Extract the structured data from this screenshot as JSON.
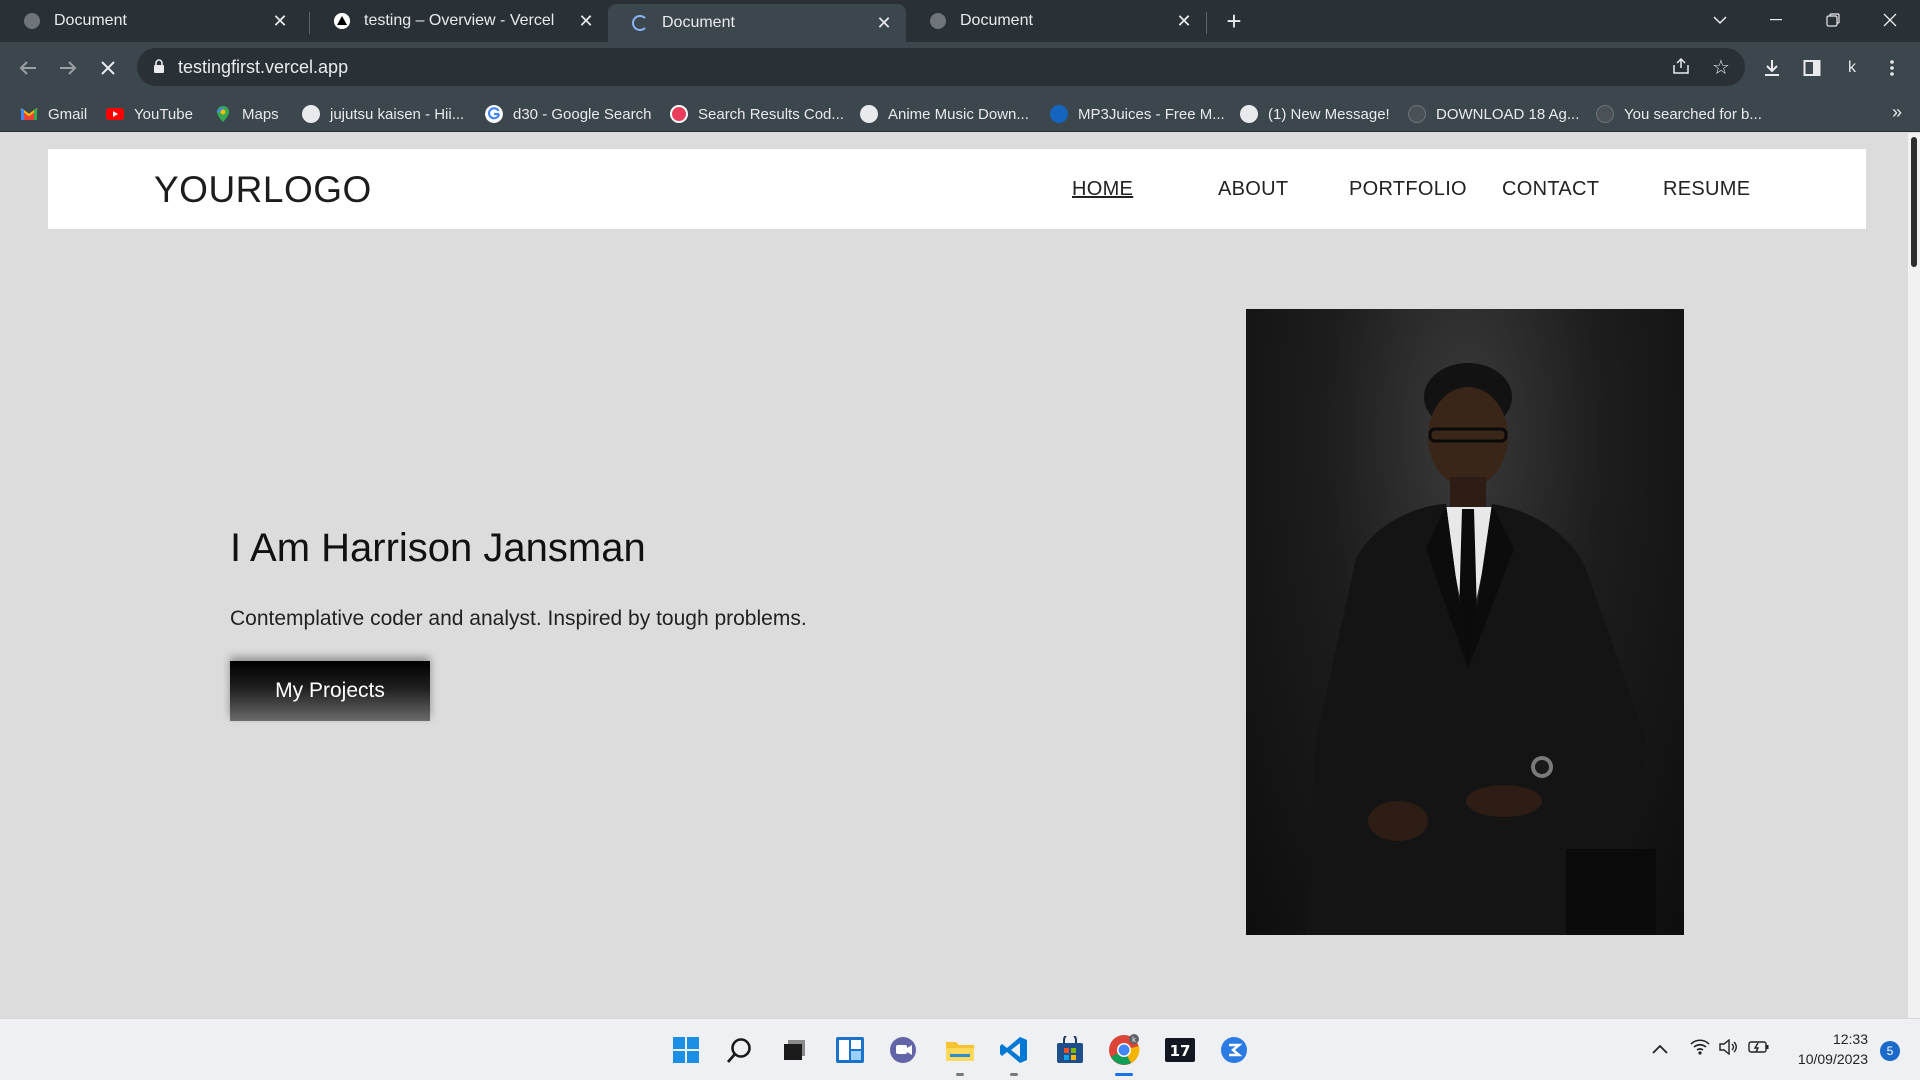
{
  "browser": {
    "tabs": [
      {
        "title": "Document",
        "active": false
      },
      {
        "title": "testing – Overview - Vercel",
        "active": false
      },
      {
        "title": "Document",
        "active": true
      },
      {
        "title": "Document",
        "active": false
      }
    ],
    "url": "testingfirst.vercel.app",
    "profile_initial": "k",
    "bookmarks": [
      {
        "label": "Gmail"
      },
      {
        "label": "YouTube"
      },
      {
        "label": "Maps"
      },
      {
        "label": "jujutsu kaisen - Hii..."
      },
      {
        "label": "d30 - Google Search"
      },
      {
        "label": "Search Results Cod..."
      },
      {
        "label": "Anime Music Down..."
      },
      {
        "label": "MP3Juices - Free M..."
      },
      {
        "label": "(1) New Message!"
      },
      {
        "label": "DOWNLOAD 18 Ag..."
      },
      {
        "label": "You searched for b..."
      }
    ],
    "bookmarks_overflow": "»"
  },
  "site": {
    "logo": "YOURLOGO",
    "nav": [
      {
        "label": "HOME",
        "active": true
      },
      {
        "label": "ABOUT",
        "active": false
      },
      {
        "label": "PORTFOLIO",
        "active": false
      },
      {
        "label": "CONTACT",
        "active": false
      },
      {
        "label": "RESUME",
        "active": false
      }
    ],
    "hero": {
      "title": "I Am Harrison Jansman",
      "subtitle": "Contemplative coder and analyst. Inspired by tough problems.",
      "button": "My Projects"
    }
  },
  "taskbar": {
    "time": "12:33",
    "date": "10/09/2023",
    "notification_count": "5",
    "apps": [
      "windows-start",
      "search",
      "task-view",
      "widgets",
      "teams-chat",
      "file-explorer",
      "vscode",
      "microsoft-store",
      "chrome",
      "tradingview",
      "app"
    ]
  },
  "colors": {
    "page_bg": "#dcdcdc",
    "header_bg": "#ffffff",
    "chrome_dark": "#2a3136",
    "chrome_toolbar": "#3c464d"
  }
}
